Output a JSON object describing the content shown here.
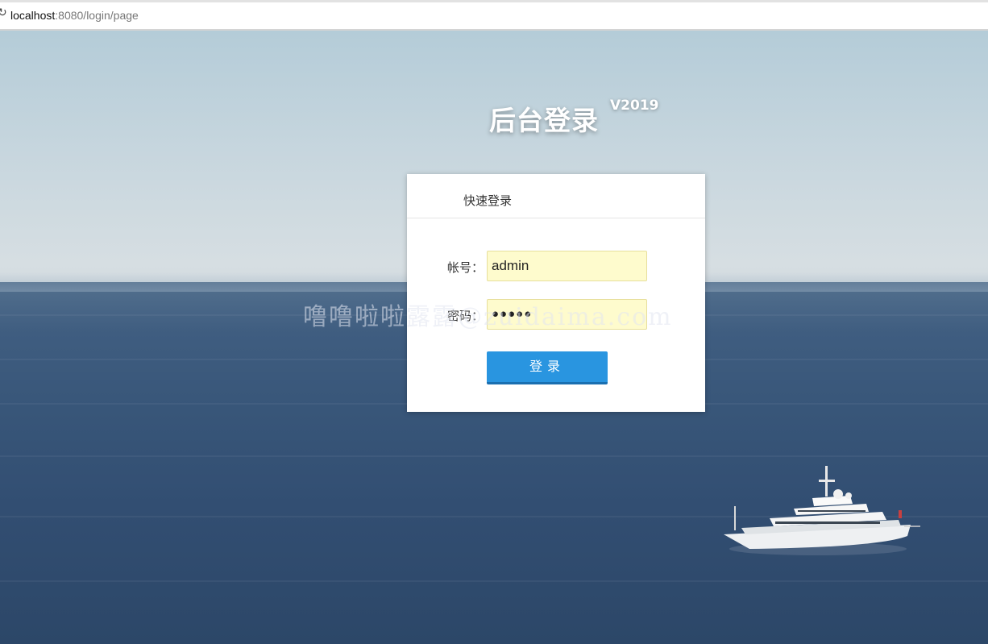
{
  "browser": {
    "url_host": "localhost",
    "url_rest": ":8080/login/page"
  },
  "page": {
    "heading": "后台登录",
    "version": "V2019"
  },
  "login": {
    "title": "快速登录",
    "account_label": "帐号：",
    "account_value": "admin",
    "password_label": "密码：",
    "password_value": "●●●●●",
    "submit_label": "登录"
  },
  "watermark": "噜噜啦啦露露@zuidaima.com",
  "colors": {
    "button": "#2995e0",
    "input_autofill": "#fefbcd"
  }
}
